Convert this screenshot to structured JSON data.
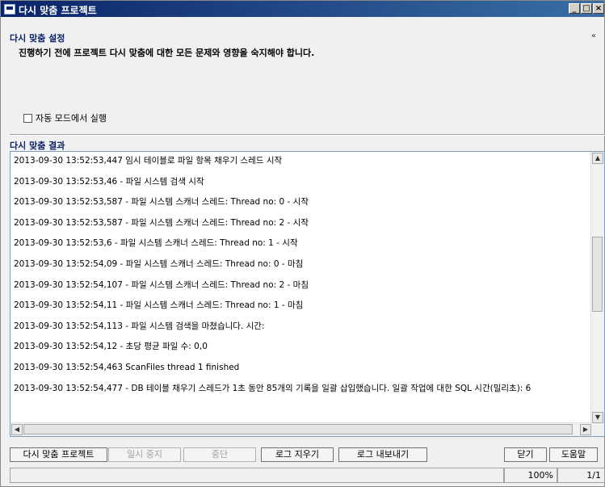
{
  "window": {
    "title": "다시 맞춤 프로젝트",
    "controls": [
      "minimize-icon",
      "maximize-icon",
      "close-icon"
    ]
  },
  "settings": {
    "header": "다시 맞춤 설정",
    "collapse_glyph": "«",
    "description": "진행하기 전에 프로젝트 다시 맞춤에 대한 모든 문제와 영향을 숙지해야 합니다.",
    "auto_mode_label": "자동 모드에서 실행",
    "auto_mode_checked": false
  },
  "results": {
    "header": "다시 맞춤 결과",
    "log": [
      "2013-09-30 13:52:53,447 임시 테이블로 파일 항목 채우기 스레드 시작",
      "2013-09-30 13:52:53,46    - 파일 시스템 검색 시작",
      "2013-09-30 13:52:53,587    - 파일 시스템 스캐너 스레드: Thread no: 0 - 시작",
      "2013-09-30 13:52:53,587    - 파일 시스템 스캐너 스레드: Thread no: 2 - 시작",
      "2013-09-30 13:52:53,6    - 파일 시스템 스캐너 스레드: Thread no: 1 - 시작",
      "2013-09-30 13:52:54,09    - 파일 시스템 스캐너 스레드: Thread no: 0 - 마침",
      "2013-09-30 13:52:54,107    - 파일 시스템 스캐너 스레드: Thread no: 2 - 마침",
      "2013-09-30 13:52:54,11    - 파일 시스템 스캐너 스레드: Thread no: 1 - 마침",
      "2013-09-30 13:52:54,113    - 파일 시스템 검색을 마쳤습니다. 시간:",
      "2013-09-30 13:52:54,12    - 초당 평균 파일 수: 0,0",
      "2013-09-30 13:52:54,463 ScanFiles thread 1 finished",
      "2013-09-30 13:52:54,477    - DB 테이블 채우기 스레드가 1초 동안 85개의 기록을 일괄 삽입했습니다. 일괄 작업에 대한 SQL 시간(밀리초): 6"
    ]
  },
  "buttons": {
    "realign": "다시 맞춤 프로젝트",
    "pause": "일시 중지",
    "stop": "중단",
    "clear_log": "로그 지우기",
    "export_log": "로그 내보내기",
    "close": "닫기",
    "help": "도움말"
  },
  "status": {
    "zoom": "100%",
    "page": "1/1"
  }
}
